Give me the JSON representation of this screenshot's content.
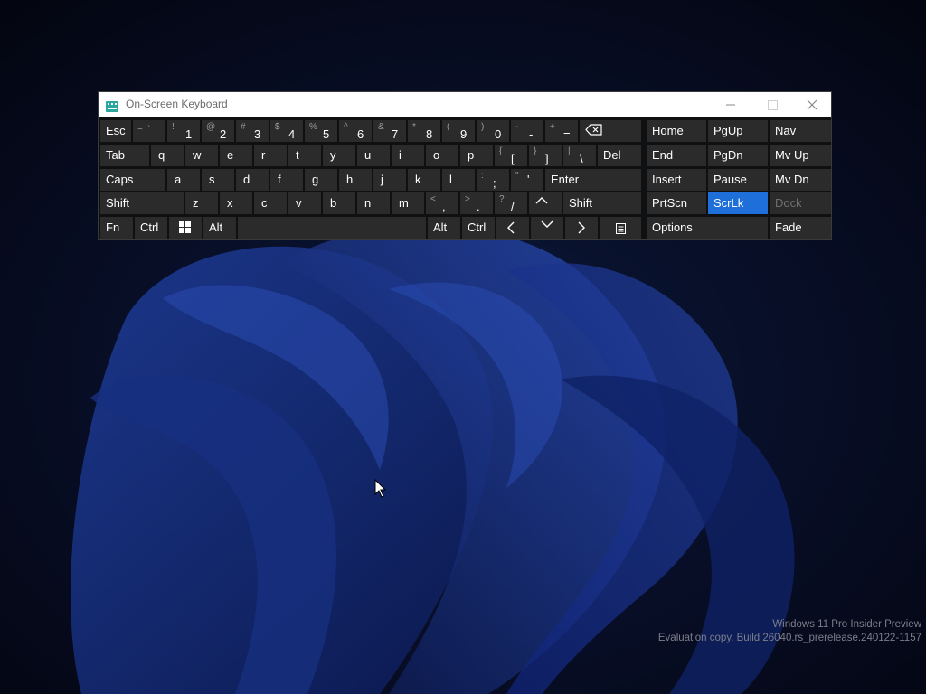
{
  "window": {
    "title": "On-Screen Keyboard"
  },
  "keyboard": {
    "row1": {
      "esc": "Esc",
      "tilde": {
        "shift": "~",
        "base": "`"
      },
      "k1": {
        "shift": "!",
        "base": "1"
      },
      "k2": {
        "shift": "@",
        "base": "2"
      },
      "k3": {
        "shift": "#",
        "base": "3"
      },
      "k4": {
        "shift": "$",
        "base": "4"
      },
      "k5": {
        "shift": "%",
        "base": "5"
      },
      "k6": {
        "shift": "^",
        "base": "6"
      },
      "k7": {
        "shift": "&",
        "base": "7"
      },
      "k8": {
        "shift": "*",
        "base": "8"
      },
      "k9": {
        "shift": "(",
        "base": "9"
      },
      "k0": {
        "shift": ")",
        "base": "0"
      },
      "minus": {
        "shift": "-",
        "base": "-"
      },
      "equals": {
        "shift": "+",
        "base": "="
      }
    },
    "row2": {
      "tab": "Tab",
      "letters": [
        "q",
        "w",
        "e",
        "r",
        "t",
        "y",
        "u",
        "i",
        "o",
        "p"
      ],
      "lbracket": {
        "shift": "{",
        "base": "["
      },
      "rbracket": {
        "shift": "}",
        "base": "]"
      },
      "backslash": {
        "shift": "|",
        "base": "\\"
      },
      "del": "Del"
    },
    "row3": {
      "caps": "Caps",
      "letters": [
        "a",
        "s",
        "d",
        "f",
        "g",
        "h",
        "j",
        "k",
        "l"
      ],
      "semicolon": {
        "shift": ":",
        "base": ";"
      },
      "quote": {
        "shift": "\"",
        "base": "'"
      },
      "enter": "Enter"
    },
    "row4": {
      "shift_left": "Shift",
      "letters": [
        "z",
        "x",
        "c",
        "v",
        "b",
        "n",
        "m"
      ],
      "comma": {
        "shift": "<",
        "base": ","
      },
      "period": {
        "shift": ">",
        "base": "."
      },
      "slash": {
        "shift": "?",
        "base": "/"
      },
      "shift_right": "Shift"
    },
    "row5": {
      "fn": "Fn",
      "ctrl_left": "Ctrl",
      "alt_left": "Alt",
      "alt_right": "Alt",
      "ctrl_right": "Ctrl"
    },
    "nav": {
      "home": "Home",
      "pgup": "PgUp",
      "nav": "Nav",
      "end": "End",
      "pgdn": "PgDn",
      "mvup": "Mv Up",
      "insert": "Insert",
      "pause": "Pause",
      "mvdn": "Mv Dn",
      "prtscn": "PrtScn",
      "scrlk": "ScrLk",
      "dock": "Dock",
      "options": "Options",
      "fade": "Fade"
    }
  },
  "watermark": {
    "line1": "Windows 11 Pro Insider Preview",
    "line2": "Evaluation copy. Build 26040.rs_prerelease.240122-1157"
  },
  "colors": {
    "active_key": "#1e6fd9",
    "key": "#2b2b2b",
    "key_text": "#ffffff",
    "disabled_text": "#6f6f6f"
  }
}
